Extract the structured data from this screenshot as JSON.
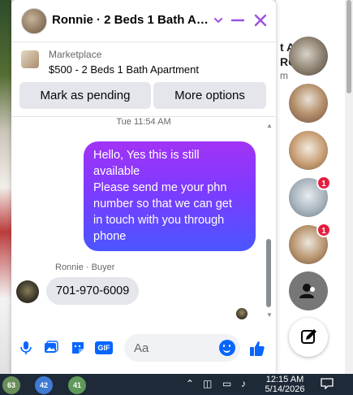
{
  "chat": {
    "title": "Ronnie · 2 Beds 1 Bath Apa...",
    "listing_source": "Marketplace",
    "listing_title": "$500 - 2 Beds 1 Bath Apartment",
    "mark_pending_label": "Mark as pending",
    "more_options_label": "More options",
    "timestamp": "Tue 11:54 AM",
    "outgoing_message_lines": [
      "Hello, Yes this is still",
      "available",
      "Please send me your phn",
      "number so that we can get",
      "in touch with you through",
      "phone"
    ],
    "sender_label": "Ronnie · Buyer",
    "incoming_message": "701-970-6009",
    "composer_placeholder": "Aa",
    "gif_label": "GIF"
  },
  "background": {
    "text_line1": "t A",
    "text_line2": "RO",
    "text_line3": "m"
  },
  "sidebar": {
    "badges": [
      "1",
      "1"
    ]
  },
  "taskbar": {
    "app_badges": [
      "63",
      "42",
      "41"
    ],
    "time": "12:15 AM",
    "date": "5/14/2026"
  },
  "colors": {
    "accent": "#9b51e0",
    "messenger_blue": "#0866ff",
    "bubble_gradient_start": "#a233f5",
    "bubble_gradient_end": "#4a56ff",
    "badge_red": "#e41e3f"
  }
}
